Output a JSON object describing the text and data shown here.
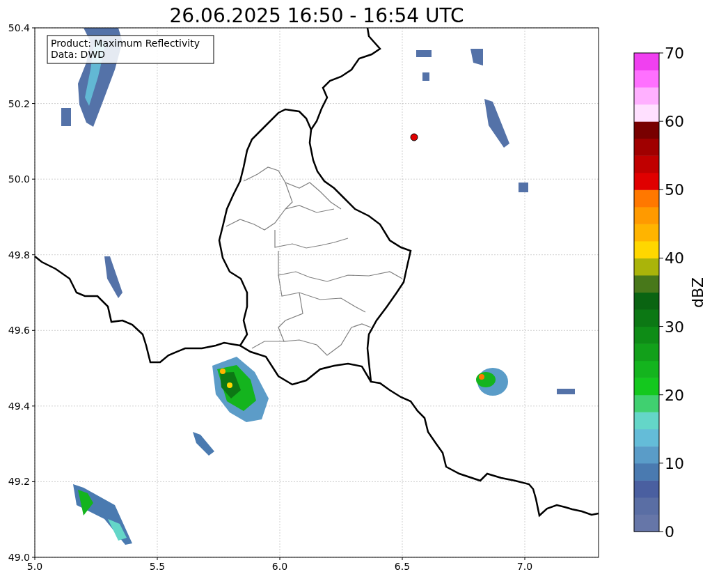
{
  "title": "26.06.2025 16:50 - 16:54 UTC",
  "map": {
    "legend": [
      "Product: Maximum Reflectivity",
      "Data: DWD"
    ],
    "xticks": [
      "5.0",
      "5.5",
      "6.0",
      "6.5",
      "7.0"
    ],
    "yticks": [
      "50.4",
      "50.2",
      "50.0",
      "49.8",
      "49.6",
      "49.4",
      "49.2",
      "49.0"
    ]
  },
  "colorbar": {
    "label": "dBZ",
    "ticks": [
      "70",
      "60",
      "50",
      "40",
      "30",
      "20",
      "10",
      "0"
    ],
    "segments": [
      {
        "color": "#6676a8"
      },
      {
        "color": "#5a6ea4"
      },
      {
        "color": "#4a5fa0"
      },
      {
        "color": "#4a7ab0"
      },
      {
        "color": "#5a9cc8"
      },
      {
        "color": "#64bcd8"
      },
      {
        "color": "#64d6c8"
      },
      {
        "color": "#40d070"
      },
      {
        "color": "#14c81e"
      },
      {
        "color": "#14b41e"
      },
      {
        "color": "#12a01a"
      },
      {
        "color": "#0e8c16"
      },
      {
        "color": "#0c7814"
      },
      {
        "color": "#0a6412"
      },
      {
        "color": "#48781a"
      },
      {
        "color": "#aab40a"
      },
      {
        "color": "#ffd700"
      },
      {
        "color": "#ffb400"
      },
      {
        "color": "#ff9a00"
      },
      {
        "color": "#ff7800"
      },
      {
        "color": "#e00000"
      },
      {
        "color": "#c00000"
      },
      {
        "color": "#a00000"
      },
      {
        "color": "#780000"
      },
      {
        "color": "#ffe0ff"
      },
      {
        "color": "#ffb0ff"
      },
      {
        "color": "#ff70ff"
      },
      {
        "color": "#f040f0"
      }
    ]
  }
}
